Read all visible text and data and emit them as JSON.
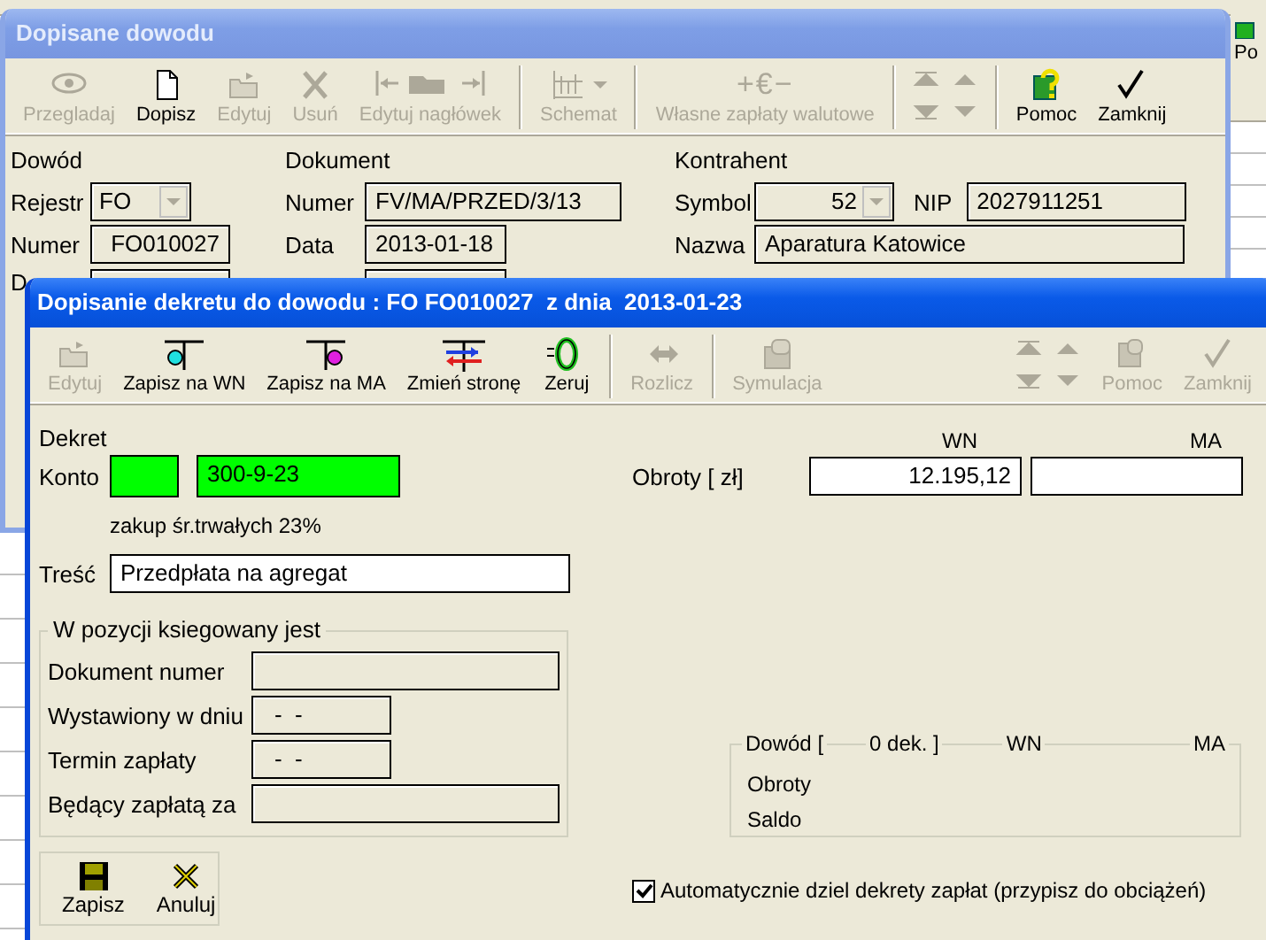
{
  "background_app": {
    "toolbar_label": "Po"
  },
  "back_window": {
    "title": "Dopisane dowodu",
    "toolbar": [
      {
        "kind": "button",
        "label": "Przegladaj",
        "disabled": true
      },
      {
        "kind": "button",
        "label": "Dopisz",
        "disabled": false
      },
      {
        "kind": "button",
        "label": "Edytuj",
        "disabled": true
      },
      {
        "kind": "button",
        "label": "Usuń",
        "disabled": true
      },
      {
        "kind": "button",
        "label": "Edytuj nagłówek",
        "disabled": true
      },
      {
        "kind": "separator"
      },
      {
        "kind": "menu-button",
        "label": "Schemat",
        "disabled": true
      },
      {
        "kind": "separator"
      },
      {
        "kind": "text-button",
        "icon_text": "+€−",
        "label": "Własne zapłaty walutowe",
        "disabled": true
      },
      {
        "kind": "separator"
      },
      {
        "kind": "nav",
        "disabled": true
      },
      {
        "kind": "separator"
      },
      {
        "kind": "button",
        "label": "Pomoc",
        "disabled": false
      },
      {
        "kind": "button",
        "label": "Zamknij",
        "disabled": false
      }
    ],
    "dowod": {
      "heading": "Dowód",
      "rejestr": {
        "label": "Rejestr",
        "value": "FO"
      },
      "numer": {
        "label": "Numer",
        "value": "FO010027"
      },
      "row_3_label": "D"
    },
    "dokument": {
      "heading": "Dokument",
      "numer": {
        "label": "Numer",
        "value": "FV/MA/PRZED/3/13"
      },
      "data": {
        "label": "Data",
        "value": "2013-01-18"
      }
    },
    "kontrahent": {
      "heading": "Kontrahent",
      "symbol": {
        "label": "Symbol",
        "value": "52"
      },
      "nip": {
        "label": "NIP",
        "value": "2027911251"
      },
      "nazwa": {
        "label": "Nazwa",
        "value": "Aparatura Katowice"
      }
    }
  },
  "front_window": {
    "title": "Dopisanie dekretu do dowodu : FO FO010027  z dnia  2013-01-23",
    "toolbar": [
      {
        "kind": "button",
        "label": "Edytuj",
        "disabled": true
      },
      {
        "kind": "button",
        "label": "Zapisz na WN",
        "disabled": false
      },
      {
        "kind": "button",
        "label": "Zapisz na MA",
        "disabled": false
      },
      {
        "kind": "button",
        "label": "Zmień stronę",
        "disabled": false
      },
      {
        "kind": "button",
        "label": "Zeruj",
        "disabled": false
      },
      {
        "kind": "separator"
      },
      {
        "kind": "button",
        "label": "Rozlicz",
        "disabled": true
      },
      {
        "kind": "separator"
      },
      {
        "kind": "button",
        "label": "Symulacja",
        "disabled": true
      },
      {
        "kind": "spacer"
      },
      {
        "kind": "nav",
        "disabled": true
      },
      {
        "kind": "button",
        "label": "Pomoc",
        "disabled": true
      },
      {
        "kind": "button",
        "label": "Zamknij",
        "disabled": true
      }
    ],
    "dekret": {
      "heading": "Dekret",
      "konto_label": "Konto",
      "konto_value": "300-9-23",
      "konto_description": "zakup śr.trwałych 23%"
    },
    "obroty": {
      "label": "Obroty [ zł]",
      "wn_heading": "WN",
      "ma_heading": "MA",
      "wn_value": "12.195,12"
    },
    "tresc": {
      "label": "Treść",
      "value": "Przedpłata na agregat"
    },
    "pozycja": {
      "title": "W pozycji ksiegowany jest",
      "rows": [
        {
          "label": "Dokument numer",
          "kind": "wide"
        },
        {
          "label": "Wystawiony w dniu",
          "value": "-  -",
          "kind": "short"
        },
        {
          "label": "Termin zapłaty",
          "value": "-  -",
          "kind": "short"
        },
        {
          "label": "Będący zapłatą za",
          "kind": "wide"
        }
      ]
    },
    "dowod_summary": {
      "title": "Dowód [",
      "count": "0 dek. ]",
      "wn_heading": "WN",
      "ma_heading": "MA",
      "rows": [
        "Obroty",
        "Saldo"
      ]
    },
    "buttons": [
      "Zapisz",
      "Anuluj"
    ],
    "auto_split": {
      "label": "Automatycznie dziel dekrety zapłat (przypisz do obciążeń)",
      "checked": true
    }
  }
}
